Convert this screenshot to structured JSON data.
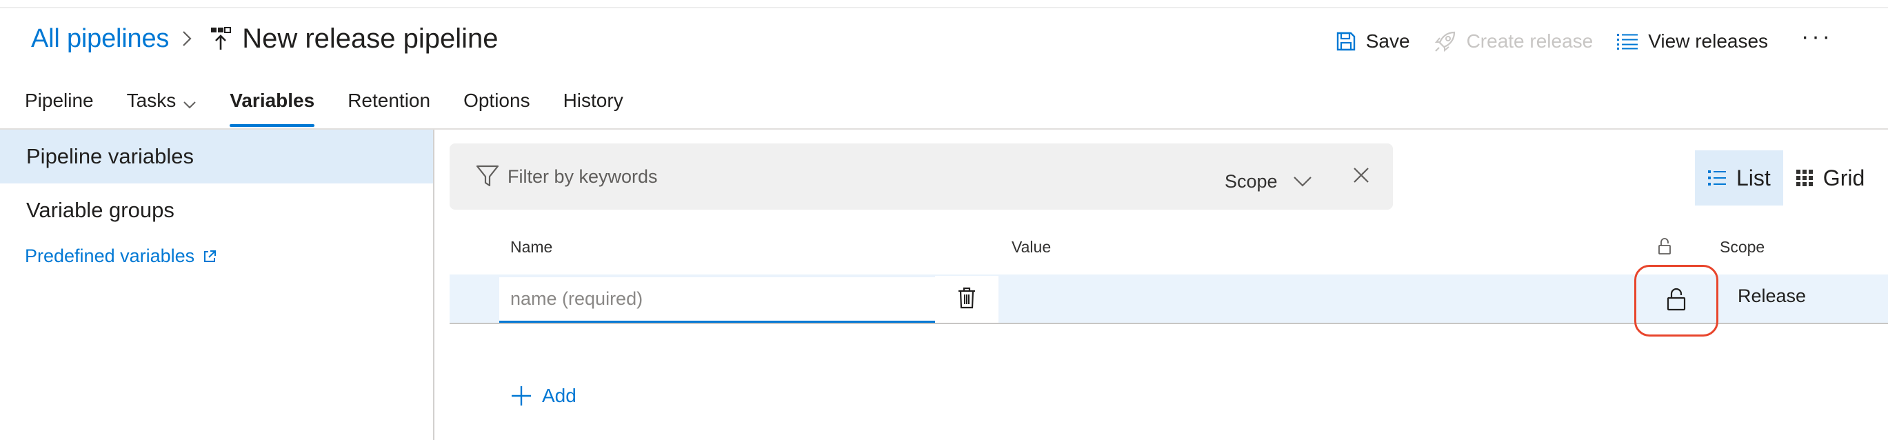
{
  "header": {
    "breadcrumb_link": "All pipelines",
    "title": "New release pipeline",
    "actions": {
      "save": "Save",
      "create_release": "Create release",
      "view_releases": "View releases",
      "more": "···"
    }
  },
  "tabs": [
    {
      "label": "Pipeline"
    },
    {
      "label": "Tasks"
    },
    {
      "label": "Variables"
    },
    {
      "label": "Retention"
    },
    {
      "label": "Options"
    },
    {
      "label": "History"
    }
  ],
  "active_tab": "Variables",
  "left_panel": {
    "items": [
      {
        "label": "Pipeline variables",
        "selected": true
      },
      {
        "label": "Variable groups",
        "selected": false
      }
    ],
    "link": "Predefined variables"
  },
  "filter": {
    "placeholder": "Filter by keywords",
    "scope_label": "Scope"
  },
  "view_toggle": {
    "list": "List",
    "grid": "Grid",
    "active": "List"
  },
  "table": {
    "columns": {
      "name": "Name",
      "value": "Value",
      "scope": "Scope"
    },
    "rows": [
      {
        "name_value": "",
        "name_placeholder": "name (required)",
        "value": "",
        "scope": "Release"
      }
    ]
  },
  "add_label": "Add",
  "colors": {
    "accent": "#0078d4",
    "selected_bg": "#deecf9",
    "row_bg": "#eaf3fc",
    "highlight_ring": "#e8452c",
    "filter_bg": "#f0f0f0"
  },
  "icons": [
    "chevron-right-icon",
    "release-pipeline-icon",
    "save-icon",
    "rocket-icon",
    "list-icon",
    "chevron-down-icon",
    "external-link-icon",
    "filter-icon",
    "close-icon",
    "grid-icon",
    "lock-icon",
    "trash-icon",
    "plus-icon"
  ]
}
